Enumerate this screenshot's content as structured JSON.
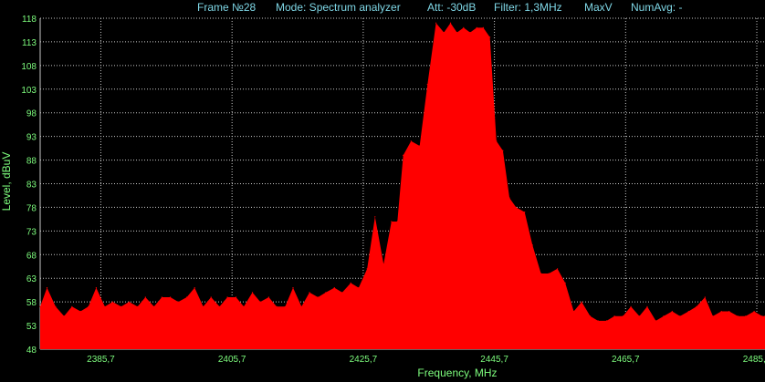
{
  "header": {
    "frame": "Frame №28",
    "mode": "Mode: Spectrum analyzer",
    "att": "Att: -30dB",
    "filter": "Filter: 1,3MHz",
    "detector": "MaxV",
    "numavg": "NumAvg: -"
  },
  "colors": {
    "fill": "#ff0000",
    "grid": "#c8c8c8",
    "axis_text": "#7dfc7d",
    "header_text": "#7fd7e6",
    "background": "#000000"
  },
  "chart_data": {
    "type": "area",
    "xlabel": "Frequency, MHz",
    "ylabel": "Level, dBuV",
    "xlim": [
      2376.45,
      2486.95
    ],
    "ylim": [
      48,
      118
    ],
    "y_ticks": [
      "118",
      "113",
      "108",
      "103",
      "98",
      "93",
      "88",
      "83",
      "78",
      "73",
      "68",
      "63",
      "58",
      "53",
      "48"
    ],
    "x_ticks": [
      "2385,7",
      "2405,7",
      "2425,7",
      "2445,7",
      "2465,7",
      "2485,7"
    ],
    "grid": true,
    "x": [
      2376.45,
      2377.5,
      2378.8,
      2380.1,
      2381.3,
      2382.6,
      2383.8,
      2385.0,
      2386.3,
      2387.5,
      2388.8,
      2390.0,
      2391.3,
      2392.5,
      2393.8,
      2395.0,
      2396.3,
      2397.5,
      2398.8,
      2400.0,
      2401.3,
      2402.5,
      2403.8,
      2405.0,
      2406.3,
      2407.5,
      2408.8,
      2410.0,
      2411.3,
      2412.5,
      2413.8,
      2415.0,
      2416.3,
      2417.5,
      2418.8,
      2420.0,
      2421.3,
      2422.5,
      2423.8,
      2425.0,
      2426.3,
      2427.5,
      2428.8,
      2430.0,
      2430.9,
      2431.8,
      2433.0,
      2434.3,
      2435.5,
      2436.8,
      2438.0,
      2439.0,
      2440.0,
      2441.0,
      2442.0,
      2443.0,
      2444.0,
      2445.0,
      2446.0,
      2447.0,
      2448.0,
      2449.0,
      2450.3,
      2451.5,
      2452.8,
      2454.0,
      2455.3,
      2456.5,
      2457.8,
      2459.0,
      2460.3,
      2461.5,
      2462.8,
      2464.0,
      2465.3,
      2466.5,
      2467.8,
      2469.0,
      2470.3,
      2471.5,
      2472.8,
      2474.0,
      2475.3,
      2476.5,
      2477.8,
      2479.0,
      2480.3,
      2481.5,
      2482.8,
      2484.0,
      2485.3,
      2486.5,
      2486.95
    ],
    "y": [
      57,
      61,
      57,
      55,
      57,
      56,
      57,
      61,
      57,
      58,
      57,
      58,
      57,
      59,
      57,
      59,
      59,
      58,
      59,
      61,
      57,
      59,
      57,
      59,
      59,
      57,
      60,
      58,
      59,
      57,
      57,
      61,
      57,
      60,
      59,
      60,
      61,
      60,
      62,
      61,
      65,
      76,
      66,
      75,
      75,
      89,
      92,
      91,
      104,
      117,
      115,
      117,
      115,
      116,
      115,
      116,
      116,
      114,
      92,
      90,
      80,
      78,
      77,
      70,
      64,
      64,
      65,
      62,
      56,
      58,
      55,
      54,
      54,
      55,
      55,
      57,
      55,
      57,
      54,
      55,
      56,
      55,
      56,
      57,
      59,
      55,
      56,
      56,
      55,
      55,
      56,
      55,
      55
    ]
  }
}
